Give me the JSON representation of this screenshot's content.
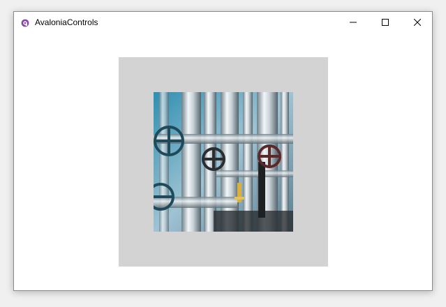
{
  "window": {
    "title": "AvaloniaControls",
    "app_icon": "avalonia-logo-icon",
    "controls": [
      "minimize-icon",
      "maximize-icon",
      "close-icon"
    ]
  },
  "content": {
    "container_color": "#d3d3d3",
    "image_subject": "industrial-pipes-and-valves-photo"
  },
  "colors": {
    "app_icon_accent": "#8b44ac",
    "window_background": "#ffffff"
  }
}
